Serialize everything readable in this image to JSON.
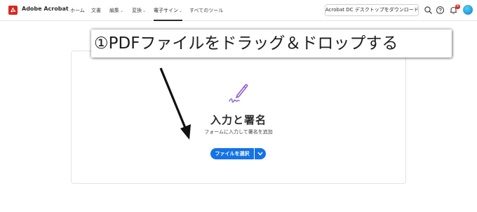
{
  "header": {
    "app_name": "Adobe Acrobat",
    "nav": [
      {
        "label": "ホーム",
        "has_menu": false
      },
      {
        "label": "文書",
        "has_menu": false
      },
      {
        "label": "編集",
        "has_menu": true
      },
      {
        "label": "変換",
        "has_menu": true
      },
      {
        "label": "電子サイン",
        "has_menu": true,
        "active": true
      },
      {
        "label": "すべてのツール",
        "has_menu": false
      }
    ],
    "download_button": "Acrobat DC デスクトップをダウンロード",
    "notification_count": "8"
  },
  "main": {
    "title": "入力と署名",
    "description": "フォームに入力して署名を追加",
    "select_button": "ファイルを選択"
  },
  "annotation": {
    "text": "①PDFファイルをドラッグ＆ドロップする"
  },
  "colors": {
    "accent": "#1473e6",
    "brand": "#d7281f",
    "tool_icon": "#8c5dd3"
  }
}
